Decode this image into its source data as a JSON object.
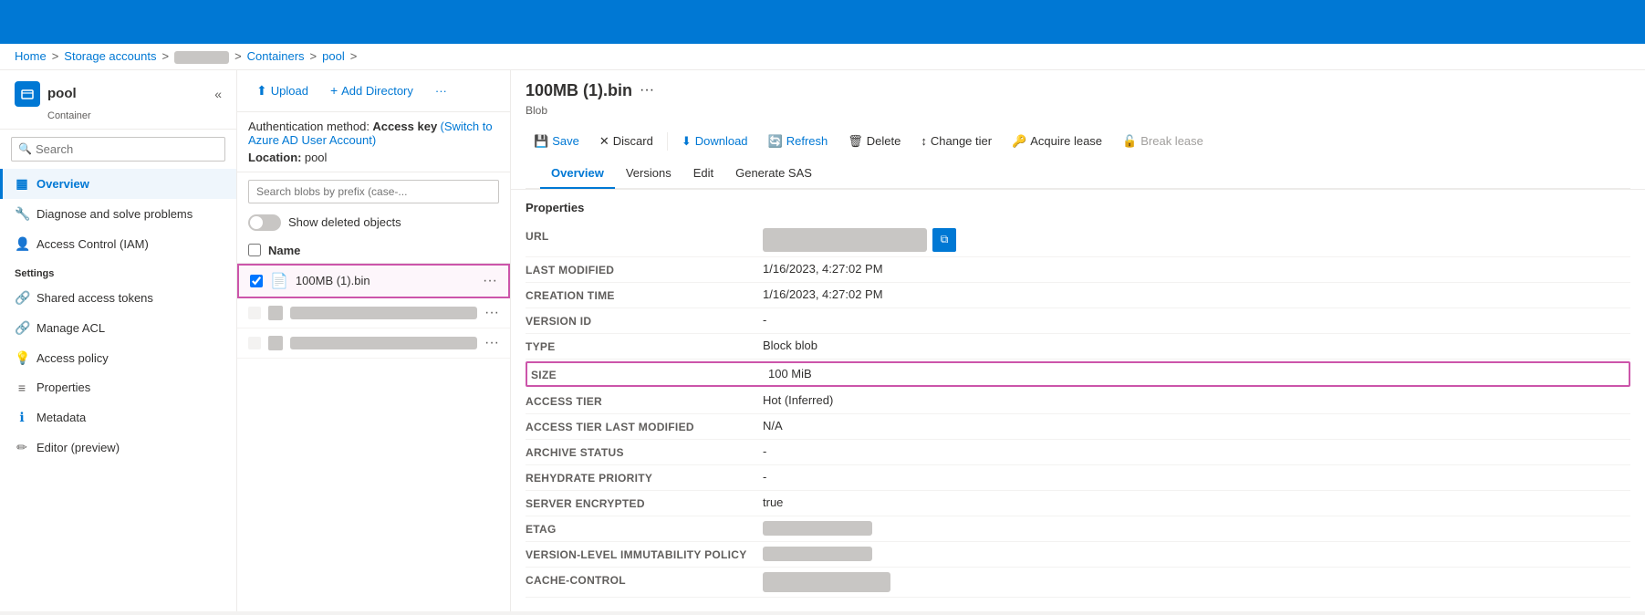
{
  "topbar": {},
  "breadcrumb": {
    "home": "Home",
    "sep1": ">",
    "storage_accounts": "Storage accounts",
    "sep2": ">",
    "account_blurred": "",
    "sep3": ">",
    "containers": "Containers",
    "sep4": ">",
    "pool": "pool",
    "sep5": ">"
  },
  "sidebar": {
    "logo_alt": "pool",
    "title": "pool",
    "subtitle": "Container",
    "search_placeholder": "Search",
    "collapse_icon": "«",
    "nav_items": [
      {
        "id": "overview",
        "label": "Overview",
        "icon": "▦",
        "active": true
      },
      {
        "id": "diagnose",
        "label": "Diagnose and solve problems",
        "icon": "🔧",
        "active": false
      },
      {
        "id": "access_control",
        "label": "Access Control (IAM)",
        "icon": "👤",
        "active": false
      }
    ],
    "settings_header": "Settings",
    "settings_items": [
      {
        "id": "shared_access",
        "label": "Shared access tokens",
        "icon": "🔗",
        "active": false
      },
      {
        "id": "manage_acl",
        "label": "Manage ACL",
        "icon": "🔗",
        "active": false
      },
      {
        "id": "access_policy",
        "label": "Access policy",
        "icon": "💡",
        "active": false
      },
      {
        "id": "properties",
        "label": "Properties",
        "icon": "≡",
        "active": false
      },
      {
        "id": "metadata",
        "label": "Metadata",
        "icon": "ℹ",
        "active": false
      },
      {
        "id": "editor",
        "label": "Editor (preview)",
        "icon": "✏",
        "active": false
      }
    ]
  },
  "center": {
    "upload_label": "Upload",
    "add_directory_label": "Add Directory",
    "more_label": "...",
    "auth_method_prefix": "Authentication method:",
    "auth_method_value": "Access key",
    "auth_link": "(Switch to Azure AD User Account)",
    "location_prefix": "Location:",
    "location_value": "pool",
    "search_placeholder": "Search blobs by prefix (case-...",
    "show_deleted_label": "Show deleted objects",
    "name_header": "Name",
    "files": [
      {
        "id": "file1",
        "name": "100MB (1).bin",
        "selected": true
      }
    ]
  },
  "right": {
    "blob_title": "100MB (1).bin",
    "blob_more": "···",
    "blob_subtitle": "Blob",
    "toolbar": {
      "save_label": "Save",
      "discard_label": "Discard",
      "download_label": "Download",
      "refresh_label": "Refresh",
      "delete_label": "Delete",
      "change_tier_label": "Change tier",
      "acquire_lease_label": "Acquire lease",
      "break_lease_label": "Break lease"
    },
    "tabs": [
      {
        "id": "overview",
        "label": "Overview",
        "active": true
      },
      {
        "id": "versions",
        "label": "Versions",
        "active": false
      },
      {
        "id": "edit",
        "label": "Edit",
        "active": false
      },
      {
        "id": "generate_sas",
        "label": "Generate SAS",
        "active": false
      }
    ],
    "properties_title": "Properties",
    "properties": [
      {
        "id": "url",
        "label": "URL",
        "value": "",
        "type": "url"
      },
      {
        "id": "last_modified",
        "label": "LAST MODIFIED",
        "value": "1/16/2023, 4:27:02 PM",
        "type": "text"
      },
      {
        "id": "creation_time",
        "label": "CREATION TIME",
        "value": "1/16/2023, 4:27:02 PM",
        "type": "text"
      },
      {
        "id": "version_id",
        "label": "VERSION ID",
        "value": "-",
        "type": "text"
      },
      {
        "id": "type",
        "label": "TYPE",
        "value": "Block blob",
        "type": "text"
      },
      {
        "id": "size",
        "label": "SIZE",
        "value": "100 MiB",
        "type": "text",
        "highlighted": true
      },
      {
        "id": "access_tier",
        "label": "ACCESS TIER",
        "value": "Hot (Inferred)",
        "type": "text"
      },
      {
        "id": "access_tier_modified",
        "label": "ACCESS TIER LAST MODIFIED",
        "value": "N/A",
        "type": "text"
      },
      {
        "id": "archive_status",
        "label": "ARCHIVE STATUS",
        "value": "-",
        "type": "text"
      },
      {
        "id": "rehydrate_priority",
        "label": "REHYDRATE PRIORITY",
        "value": "-",
        "type": "text"
      },
      {
        "id": "server_encrypted",
        "label": "SERVER ENCRYPTED",
        "value": "true",
        "type": "text"
      },
      {
        "id": "etag",
        "label": "ETAG",
        "value": "",
        "type": "blurred"
      },
      {
        "id": "version_immutability",
        "label": "VERSION-LEVEL IMMUTABILITY POLICY",
        "value": "",
        "type": "blurred"
      },
      {
        "id": "cache_control",
        "label": "CACHE-CONTROL",
        "value": "",
        "type": "blurred_input"
      }
    ]
  }
}
